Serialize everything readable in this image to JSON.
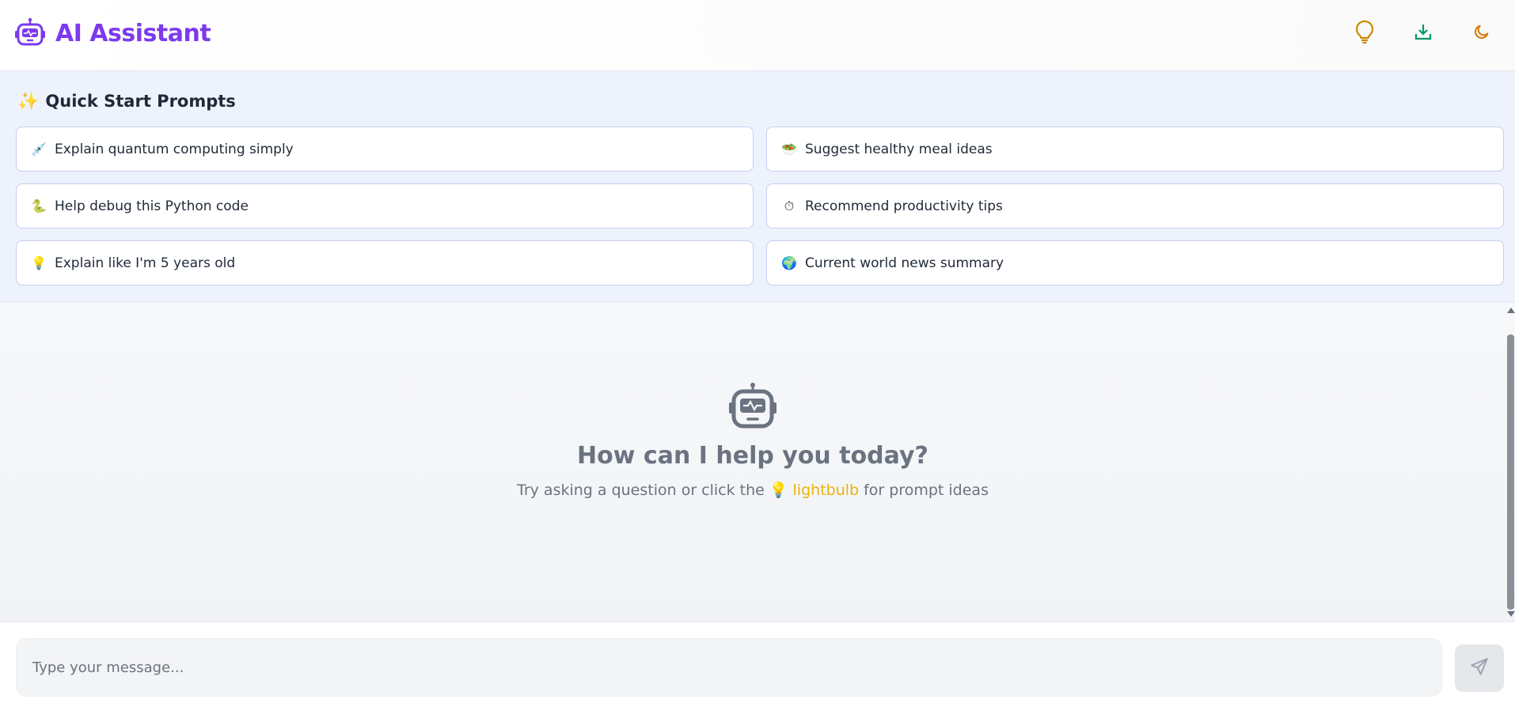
{
  "app": {
    "title": "AI Assistant",
    "brand_color": "#7c3aed"
  },
  "header": {
    "actions": [
      {
        "icon": "lightbulb-icon",
        "color": "#ca8a04"
      },
      {
        "icon": "download-icon",
        "color": "#059669"
      },
      {
        "icon": "moon-icon",
        "color": "#d97706"
      }
    ]
  },
  "quick_start": {
    "title": "Quick Start Prompts",
    "prompts": [
      {
        "emoji": "💉",
        "label": "Explain quantum computing simply"
      },
      {
        "emoji": "🥗",
        "label": "Suggest healthy meal ideas"
      },
      {
        "emoji": "🐍",
        "label": "Help debug this Python code"
      },
      {
        "emoji": "⏱",
        "label": "Recommend productivity tips"
      },
      {
        "emoji": "💡",
        "label": "Explain like I'm 5 years old"
      },
      {
        "emoji": "🌍",
        "label": "Current world news summary"
      }
    ]
  },
  "empty_state": {
    "title": "How can I help you today?",
    "subtitle_before": "Try asking a question or click the",
    "subtitle_icon": "💡",
    "subtitle_link": "lightbulb",
    "subtitle_after": "for prompt ideas"
  },
  "composer": {
    "placeholder": "Type your message...",
    "value": ""
  }
}
